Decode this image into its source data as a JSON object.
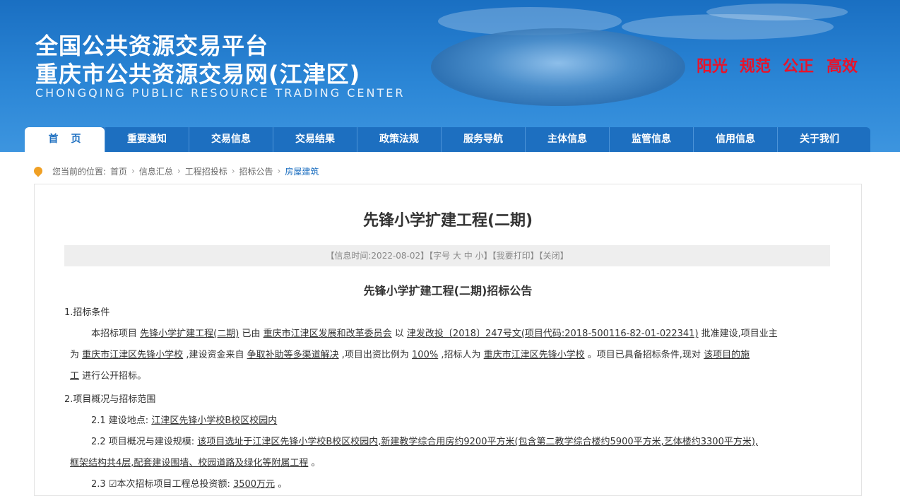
{
  "header": {
    "title_line1": "全国公共资源交易平台",
    "title_line2": "重庆市公共资源交易网(江津区)",
    "title_en": "CHONGQING PUBLIC RESOURCE TRADING CENTER",
    "slogans": [
      "阳光",
      "规范",
      "公正",
      "高效"
    ]
  },
  "nav": {
    "items": [
      "首页",
      "重要通知",
      "交易信息",
      "交易结果",
      "政策法规",
      "服务导航",
      "主体信息",
      "监管信息",
      "信用信息",
      "关于我们"
    ]
  },
  "breadcrumb": {
    "prefix": "您当前的位置:",
    "items": [
      "首页",
      "信息汇总",
      "工程招投标",
      "招标公告",
      "房屋建筑"
    ]
  },
  "article": {
    "title": "先锋小学扩建工程(二期)",
    "info_bar": "【信息时间:2022-08-02】【字号 大 中 小】【我要打印】【关闭】",
    "subtitle": "先锋小学扩建工程(二期)招标公告",
    "s1_heading": "1.招标条件",
    "s1_l1_a": "本招标项目",
    "s1_l1_b": "先锋小学扩建工程(二期)",
    "s1_l1_c": "已由",
    "s1_l1_d": "重庆市江津区发展和改革委员会",
    "s1_l1_e": "以",
    "s1_l1_f": "津发改投〔2018〕247号文(项目代码:2018-500116-82-01-022341)",
    "s1_l1_g": "批准建设,项目业主",
    "s1_l2_a": "为",
    "s1_l2_b": "重庆市江津区先锋小学校",
    "s1_l2_c": ",建设资金来自",
    "s1_l2_d": "争取补助等多渠道解决",
    "s1_l2_e": ",项目出资比例为",
    "s1_l2_f": "100%",
    "s1_l2_g": ",招标人为",
    "s1_l2_h": "重庆市江津区先锋小学校",
    "s1_l2_i": "。项目已具备招标条件,现对",
    "s1_l2_j": "该项目的施",
    "s1_l3_a": "工",
    "s1_l3_b": "进行公开招标。",
    "s2_heading": "2.项目概况与招标范围",
    "s2_1_label": "2.1 建设地点:",
    "s2_1_value": "江津区先锋小学校B校区校园内",
    "s2_2_label": "2.2 项目概况与建设规模:",
    "s2_2_value": "该项目选址于江津区先锋小学校B校区校园内,新建教学综合用房约9200平方米(包含第二教学综合楼约5900平方米,艺体楼约3300平方米),",
    "s2_2_value2": "框架结构共4层,配套建设围墙、校园道路及绿化等附属工程",
    "s2_2_end": "。",
    "s2_3_label": "2.3 ☑本次招标项目工程总投资额:",
    "s2_3_value": "3500万元",
    "s2_3_end": "。"
  },
  "colors": {
    "banner": "#2b86d6",
    "nav": "#1d6fc0",
    "slogan": "#e8132a",
    "pin": "#f0a024"
  }
}
